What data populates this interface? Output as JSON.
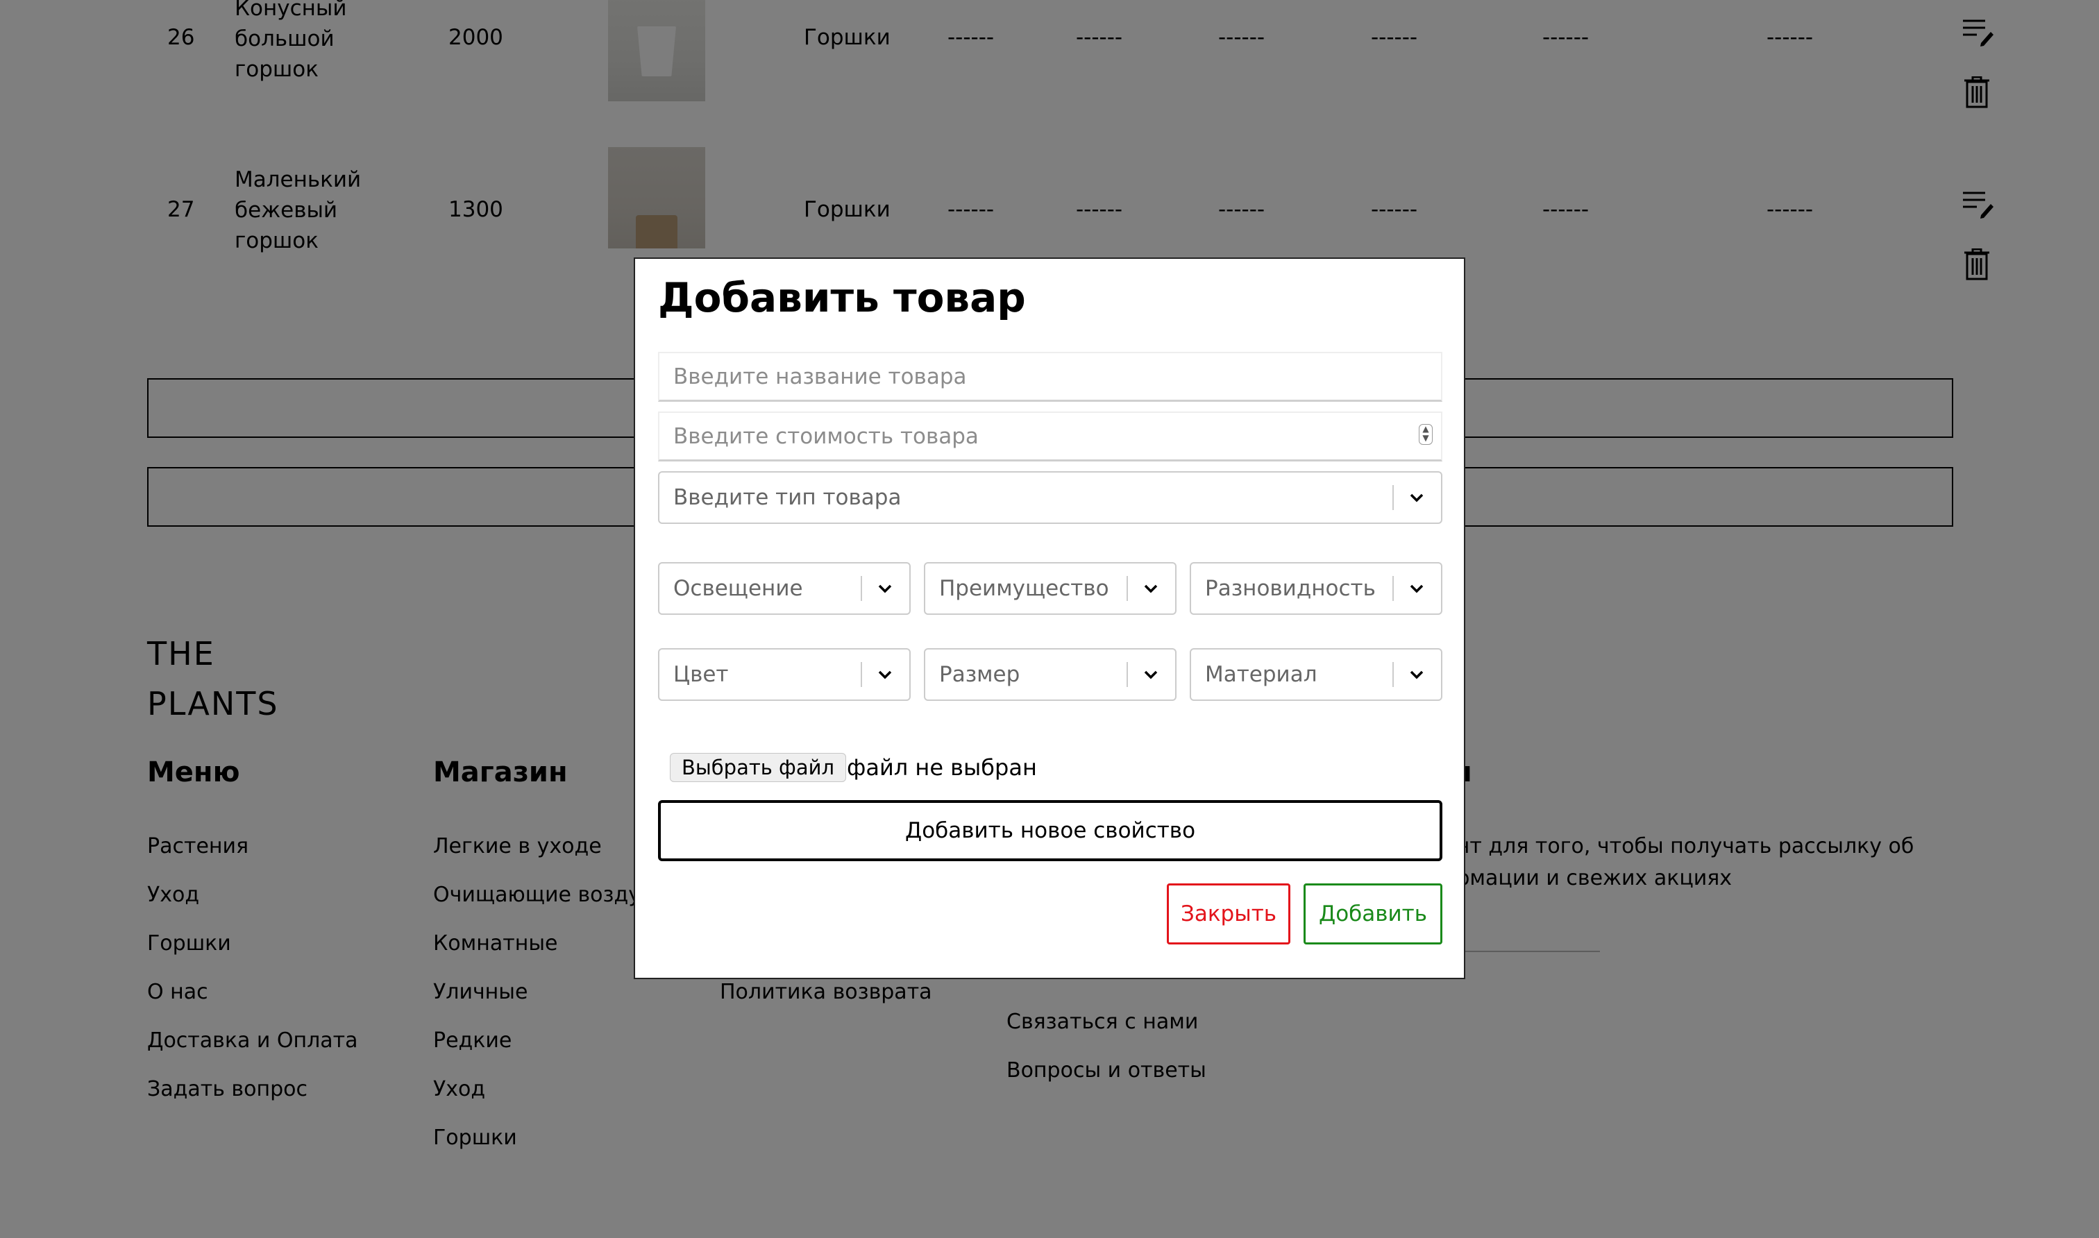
{
  "table": {
    "rows": [
      {
        "id": "26",
        "name": "Конусный\nбольшой\nгоршок",
        "price": "2000",
        "image_icon": "white-cone-pot-photo",
        "category": "Горшки",
        "props": [
          "------",
          "------",
          "------",
          "------",
          "------",
          "------"
        ],
        "edit_icon": "edit-list-icon",
        "delete_icon": "trash-icon"
      },
      {
        "id": "27",
        "name": "Маленький\nбежевый\nгоршок",
        "price": "1300",
        "image_icon": "beige-pot-photo",
        "category": "Горшки",
        "props": [
          "------",
          "------",
          "------",
          "------",
          "------",
          "------"
        ],
        "edit_icon": "edit-list-icon",
        "delete_icon": "trash-icon"
      }
    ]
  },
  "footer": {
    "logo": "THE\nPLANTS",
    "columns": [
      {
        "heading": "Меню",
        "links": [
          "Растения",
          "Уход",
          "Горшки",
          "О нас",
          "Доставка и Оплата",
          "Задать вопрос"
        ]
      },
      {
        "heading": "Магазин",
        "links": [
          "Легкие в уходе",
          "Очищающие возду",
          "Комнатные",
          "Уличные",
          "Редкие",
          "Уход",
          "Горшки"
        ]
      },
      {
        "links": [
          "Политика возврата"
        ]
      },
      {
        "links": [
          "Связаться с нами",
          "Вопросы и ответы"
        ]
      },
      {
        "heading_partial": "я",
        "text": "унт для того, чтобы получать рассылку об\nормации и свежих акциях"
      }
    ]
  },
  "modal": {
    "title": "Добавить товар",
    "name_placeholder": "Введите название товара",
    "price_placeholder": "Введите стоимость товара",
    "type_placeholder": "Введите тип товара",
    "selects_row1": [
      "Освещение",
      "Преимущество",
      "Разновидность"
    ],
    "selects_row2": [
      "Цвет",
      "Размер",
      "Материал"
    ],
    "file_button": "Выбрать файл",
    "file_status": "файл не выбран",
    "add_property_button": "Добавить новое свойство",
    "close_button": "Закрыть",
    "submit_button": "Добавить",
    "colors": {
      "close": "#e3141b",
      "submit": "#1a8a1a",
      "overlay": "rgba(0,0,0,0.5)"
    }
  }
}
